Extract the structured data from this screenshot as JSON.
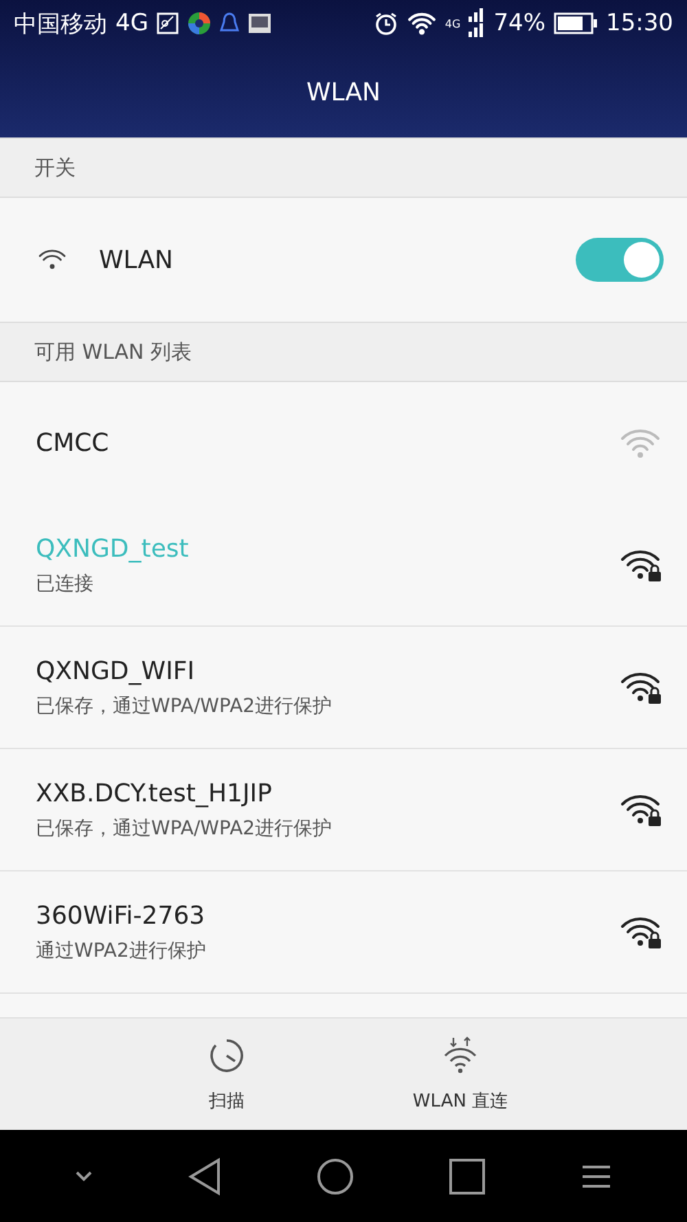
{
  "status_bar": {
    "carrier": "中国移动",
    "network": "4G",
    "signal_label": "4G",
    "battery": "74%",
    "time": "15:30"
  },
  "title": "WLAN",
  "switch_section": {
    "header": "开关",
    "label": "WLAN",
    "on": true
  },
  "list_section": {
    "header": "可用 WLAN 列表"
  },
  "networks": [
    {
      "name": "CMCC",
      "connected": false,
      "secured": false
    },
    {
      "name": "QXNGD_test",
      "status": "已连接",
      "connected": true,
      "secured": true
    },
    {
      "name": "QXNGD_WIFI",
      "status": "已保存，通过WPA/WPA2进行保护",
      "connected": false,
      "secured": true
    },
    {
      "name": "XXB.DCY.test_H1JIP",
      "status": "已保存，通过WPA/WPA2进行保护",
      "connected": false,
      "secured": true
    },
    {
      "name": "360WiFi-2763",
      "status": "通过WPA2进行保护",
      "connected": false,
      "secured": true
    }
  ],
  "actions": [
    {
      "kind": "scan",
      "label": "扫描"
    },
    {
      "kind": "direct",
      "label": "WLAN 直连"
    }
  ]
}
